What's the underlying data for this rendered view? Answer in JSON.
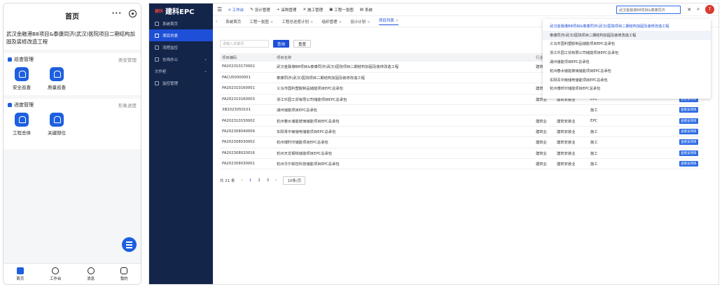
{
  "mobile": {
    "title": "首页",
    "capsule_more": "···",
    "project_name": "武汉金融港B8项目&泰康同济(武汉)医院项目二期结构加固及装修改造工程",
    "section1": {
      "title": "巡查管理",
      "link": "质安管理",
      "items": [
        {
          "label": "安全巡查",
          "icon": "bell-icon"
        },
        {
          "label": "质量巡查",
          "icon": "bell-icon"
        }
      ]
    },
    "section2": {
      "title": "进度管理",
      "link": "形象进度",
      "items": [
        {
          "label": "工程总体",
          "icon": "bell-icon"
        },
        {
          "label": "关键部位",
          "icon": "bell-icon"
        }
      ]
    },
    "tabbar": [
      {
        "label": "首页"
      },
      {
        "label": "工作台"
      },
      {
        "label": "消息"
      },
      {
        "label": "我的"
      }
    ]
  },
  "desktop": {
    "logo_mark": "建科",
    "logo_text": "建科EPC",
    "sidebar": [
      {
        "label": "系统首页"
      },
      {
        "label": "项目列表"
      },
      {
        "label": "流程监控"
      },
      {
        "label": "在线办公"
      },
      {
        "label": "文件柜"
      },
      {
        "label": "监控管理"
      }
    ],
    "topnav": [
      {
        "label": "工作台",
        "icon": "home-icon"
      },
      {
        "label": "设计管理",
        "icon": "design-icon"
      },
      {
        "label": "采购管理",
        "icon": "cart-icon"
      },
      {
        "label": "施工管理",
        "icon": "build-icon"
      },
      {
        "label": "工程一张图",
        "icon": "map-icon"
      },
      {
        "label": "系统",
        "icon": "system-icon"
      }
    ],
    "search_value": "武汉金融港B8项目&泰康同济",
    "tabs": [
      {
        "label": "系统首页"
      },
      {
        "label": "工程一张图"
      },
      {
        "label": "工程总进度计划"
      },
      {
        "label": "组织管理"
      },
      {
        "label": "设计计划"
      },
      {
        "label": "项目列表"
      }
    ],
    "filter": {
      "placeholder": "请输入关键词",
      "query": "查询",
      "reset": "重置"
    },
    "table": {
      "headers": [
        "项目编码",
        "项目名称",
        "行业",
        "",
        "",
        "",
        "操作"
      ],
      "rows": [
        [
          "PA202310170002",
          "武汉金融港B8项目&泰康同济(武汉)医院项目二期结构加固及装修改造工程",
          "建筑业",
          "",
          "",
          "",
          ""
        ],
        [
          "PACU50000001",
          "泰康同济(武汉)医院项目二期结构加固及装修改造工程",
          "",
          "",
          "",
          "",
          ""
        ],
        [
          "PA202310160001",
          "义乌市国利塑胶制品储能项目EPC总承包",
          "建筑业",
          "",
          "",
          "",
          ""
        ],
        [
          "PA202310160003",
          "浙江乐园工贸有限公司储能项目EPC总承包",
          "建筑业",
          "建筑安装业",
          "EPC",
          "",
          "查看该项目"
        ],
        [
          "XB2023050101",
          "湖州储能项目EPC总承包",
          "",
          "",
          "施工",
          "",
          "查看该项目"
        ],
        [
          "PA202310150002",
          "杭州春水储能玻璃储能项目EPC总承包",
          "建筑业",
          "建筑安装业",
          "EPC",
          "",
          "查看该项目"
        ],
        [
          "PA202308040009",
          "东阳青中南储电储能项目EPC总承包",
          "建筑业",
          "建筑安装业",
          "施工",
          "",
          "查看该项目"
        ],
        [
          "PA202308030002",
          "杭州博时印储能项目EPC总承包",
          "建筑业",
          "建筑安装业",
          "施工",
          "",
          "查看该项目"
        ],
        [
          "PA202308020016",
          "杭州天龙钢铁储能项目EPC总承包",
          "建筑业",
          "建筑安装业",
          "施工",
          "",
          "查看该项目"
        ],
        [
          "PA202308030001",
          "杭州华尔街控科技储能项目EPC总承包",
          "建筑业",
          "建筑安装业",
          "施工",
          "",
          "查看该项目"
        ]
      ]
    },
    "pagination": {
      "total": "共 21 条",
      "pages": [
        "1",
        "2",
        "3"
      ],
      "current": "1",
      "size": "10条/页"
    },
    "dropdown": [
      "武汉金融港B8项目&泰康同济(武汉)医院项目二期结构加固及装修改造工程",
      "泰康同济(武汉)医院项目二期结构加固及装修改造工程",
      "义乌市国利塑胶制品储能项目EPC总承包",
      "浙江乐园工贸有限公司储能项目EPC总承包",
      "湖州储能项目EPC总承包",
      "杭州春水储能玻璃储能项目EPC总承包",
      "东阳青中南储电储能项目EPC总承包",
      "杭州博时印储能项目EPC总承包"
    ],
    "avatar": "T"
  }
}
